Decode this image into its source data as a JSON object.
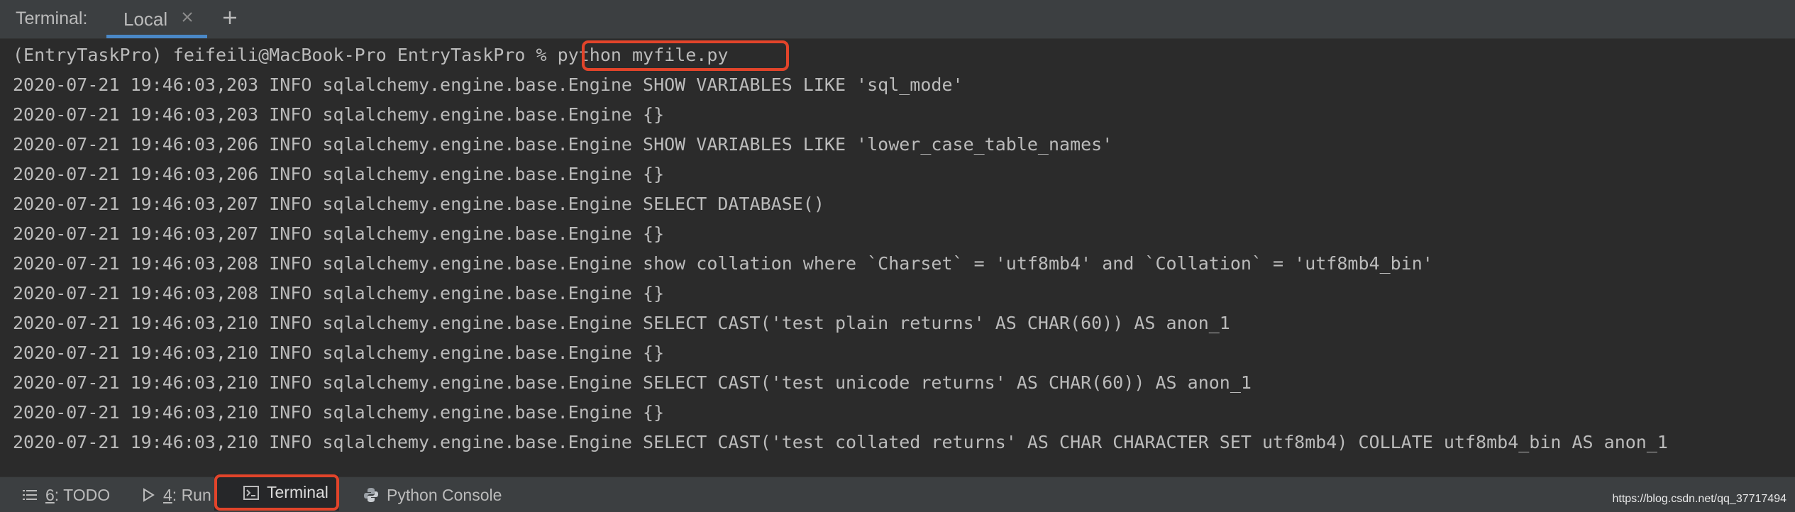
{
  "header": {
    "title": "Terminal:",
    "tab_label": "Local"
  },
  "terminal": {
    "prompt": "(EntryTaskPro) feifeili@MacBook-Pro EntryTaskPro % ",
    "command": "python myfile.py",
    "lines": [
      "2020-07-21 19:46:03,203 INFO sqlalchemy.engine.base.Engine SHOW VARIABLES LIKE 'sql_mode'",
      "2020-07-21 19:46:03,203 INFO sqlalchemy.engine.base.Engine {}",
      "2020-07-21 19:46:03,206 INFO sqlalchemy.engine.base.Engine SHOW VARIABLES LIKE 'lower_case_table_names'",
      "2020-07-21 19:46:03,206 INFO sqlalchemy.engine.base.Engine {}",
      "2020-07-21 19:46:03,207 INFO sqlalchemy.engine.base.Engine SELECT DATABASE()",
      "2020-07-21 19:46:03,207 INFO sqlalchemy.engine.base.Engine {}",
      "2020-07-21 19:46:03,208 INFO sqlalchemy.engine.base.Engine show collation where `Charset` = 'utf8mb4' and `Collation` = 'utf8mb4_bin'",
      "2020-07-21 19:46:03,208 INFO sqlalchemy.engine.base.Engine {}",
      "2020-07-21 19:46:03,210 INFO sqlalchemy.engine.base.Engine SELECT CAST('test plain returns' AS CHAR(60)) AS anon_1",
      "2020-07-21 19:46:03,210 INFO sqlalchemy.engine.base.Engine {}",
      "2020-07-21 19:46:03,210 INFO sqlalchemy.engine.base.Engine SELECT CAST('test unicode returns' AS CHAR(60)) AS anon_1",
      "2020-07-21 19:46:03,210 INFO sqlalchemy.engine.base.Engine {}",
      "2020-07-21 19:46:03,210 INFO sqlalchemy.engine.base.Engine SELECT CAST('test collated returns' AS CHAR CHARACTER SET utf8mb4) COLLATE utf8mb4_bin AS anon_1"
    ]
  },
  "bottom_bar": {
    "todo": {
      "number": "6",
      "label": ": TODO"
    },
    "run": {
      "number": "4",
      "label": ": Run"
    },
    "terminal": {
      "label": "Terminal"
    },
    "python_console": {
      "label": "Python Console"
    }
  },
  "watermark": "https://blog.csdn.net/qq_37717494",
  "icons": {
    "close": "close-icon",
    "add": "plus-icon",
    "todo": "list-icon",
    "run": "play-icon",
    "terminal": "terminal-icon",
    "python_console": "python-icon"
  },
  "colors": {
    "terminal_bg": "#2b2b2b",
    "panel_bg": "#3c3f41",
    "text": "#bbbbbb",
    "active_tab_underline": "#4a88c7",
    "highlight_red": "#e2442a"
  }
}
